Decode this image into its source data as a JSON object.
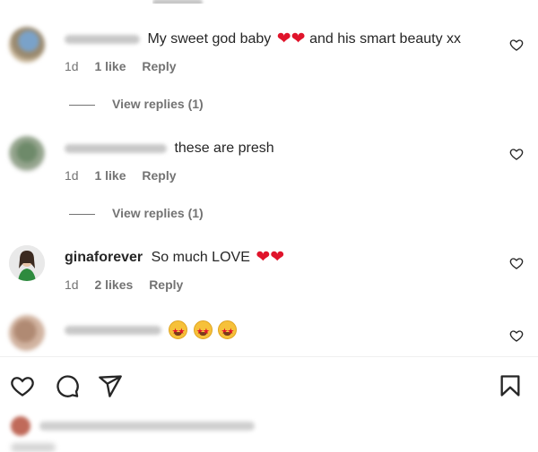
{
  "comments": [
    {
      "username": "amymellen",
      "username_blurred": true,
      "text": "My sweet god baby",
      "emoji_after_text": "❤❤",
      "text_suffix": " and his smart beauty xx",
      "time": "1d",
      "likes": "1 like",
      "reply": "Reply",
      "view_replies": "View replies (1)"
    },
    {
      "username": "morganjnelson",
      "username_blurred": true,
      "text": "these are presh",
      "time": "1d",
      "likes": "1 like",
      "reply": "Reply",
      "view_replies": "View replies (1)"
    },
    {
      "username": "ginaforever",
      "username_blurred": false,
      "text": "So much LOVE",
      "emoji_after_text": "❤❤",
      "time": "1d",
      "likes": "2 likes",
      "reply": "Reply"
    },
    {
      "username": "lulapachi_beer",
      "username_blurred": true,
      "emoji_count": 3
    }
  ],
  "colors": {
    "text": "#262626",
    "muted": "#737373",
    "heart": "#e0142b",
    "divider": "#efefef"
  },
  "icons": [
    "heart-outline-icon",
    "comment-icon",
    "send-icon",
    "bookmark-icon"
  ]
}
